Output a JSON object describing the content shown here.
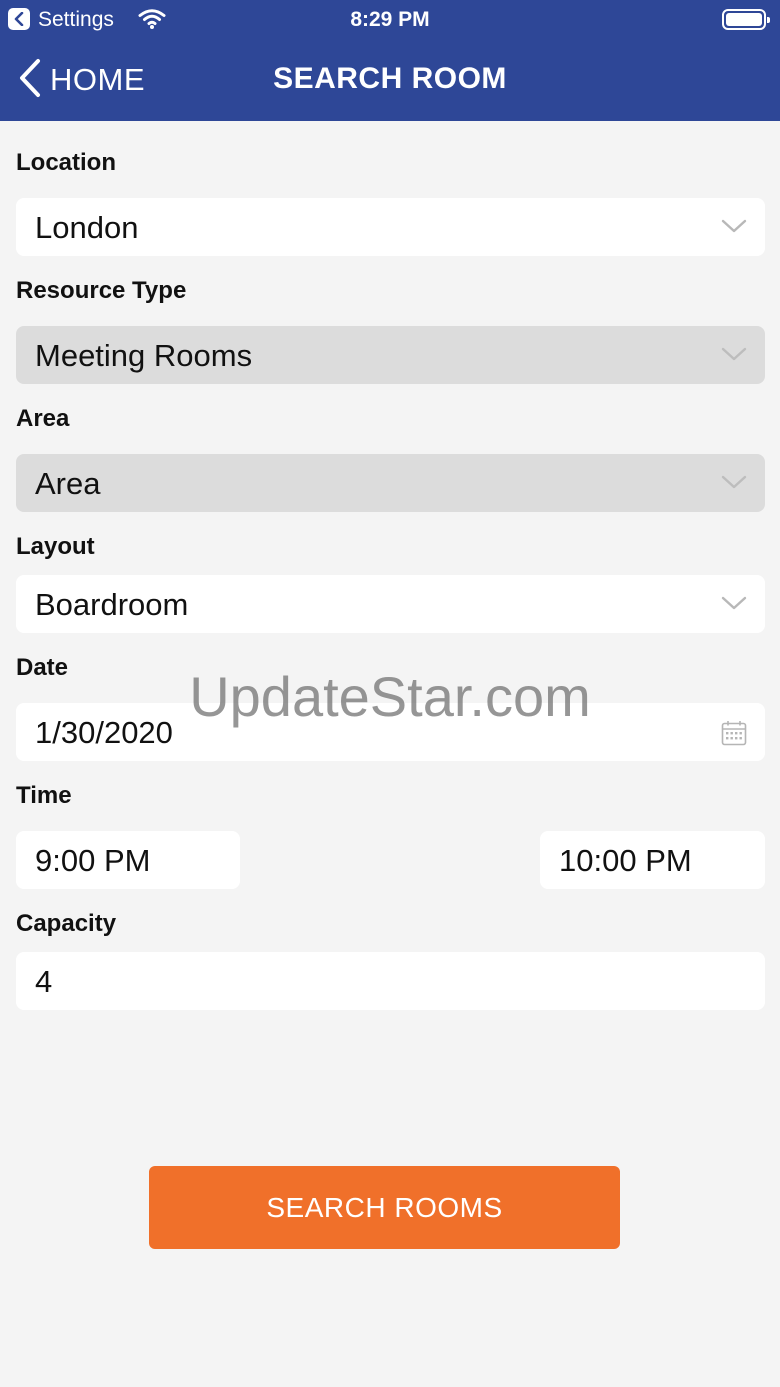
{
  "status_bar": {
    "back_app": "Settings",
    "time": "8:29 PM"
  },
  "nav": {
    "back_label": "HOME",
    "title": "SEARCH ROOM"
  },
  "form": {
    "location": {
      "label": "Location",
      "value": "London"
    },
    "resource_type": {
      "label": "Resource Type",
      "value": "Meeting Rooms"
    },
    "area": {
      "label": "Area",
      "value": "Area"
    },
    "layout": {
      "label": "Layout",
      "value": "Boardroom"
    },
    "date": {
      "label": "Date",
      "value": "1/30/2020"
    },
    "time": {
      "label": "Time",
      "start": "9:00 PM",
      "end": "10:00 PM"
    },
    "capacity": {
      "label": "Capacity",
      "value": "4"
    }
  },
  "watermark": "UpdateStar.com",
  "search_button": "SEARCH ROOMS",
  "colors": {
    "header": "#2e4797",
    "accent": "#f0702a",
    "background": "#f4f4f4",
    "disabled_field": "#dcdcdc"
  }
}
